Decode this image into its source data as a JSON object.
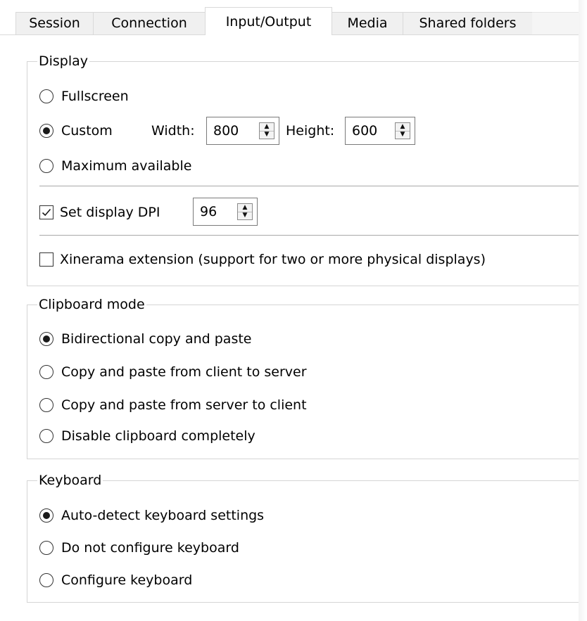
{
  "tabs": [
    {
      "label": "Session",
      "active": false
    },
    {
      "label": "Connection",
      "active": false
    },
    {
      "label": "Input/Output",
      "active": true
    },
    {
      "label": "Media",
      "active": false
    },
    {
      "label": "Shared folders",
      "active": false
    }
  ],
  "display": {
    "caption": "Display",
    "fullscreen": {
      "label": "Fullscreen",
      "selected": false
    },
    "custom": {
      "label": "Custom",
      "selected": true
    },
    "width_label": "Width:",
    "width_value": "800",
    "height_label": "Height:",
    "height_value": "600",
    "maximum": {
      "label": "Maximum available",
      "selected": false
    },
    "set_dpi": {
      "label": "Set display DPI",
      "checked": true
    },
    "dpi_value": "96",
    "xinerama": {
      "label": "Xinerama extension (support for two or more physical displays)",
      "checked": false
    }
  },
  "clipboard": {
    "caption": "Clipboard mode",
    "options": [
      {
        "label": "Bidirectional copy and paste",
        "selected": true
      },
      {
        "label": "Copy and paste from client to server",
        "selected": false
      },
      {
        "label": "Copy and paste from server to client",
        "selected": false
      },
      {
        "label": "Disable clipboard completely",
        "selected": false
      }
    ]
  },
  "keyboard": {
    "caption": "Keyboard",
    "options": [
      {
        "label": "Auto-detect keyboard settings",
        "selected": true
      },
      {
        "label": "Do not configure keyboard",
        "selected": false
      },
      {
        "label": "Configure keyboard",
        "selected": false
      }
    ]
  },
  "icons": {
    "spin_up": "caret-up-icon",
    "spin_down": "caret-down-icon",
    "checkmark": "checkmark-icon"
  },
  "colors": {
    "tab_inactive_bg": "#f0f0f0",
    "active_bg": "#ffffff",
    "border": "#d5d5d5",
    "control_border": "#333333"
  }
}
